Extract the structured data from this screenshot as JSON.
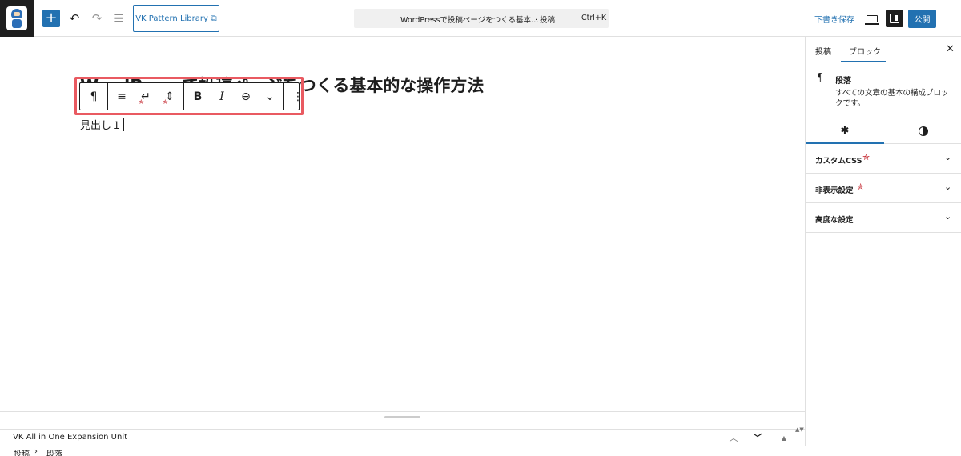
{
  "topbar": {
    "add_icon": "+",
    "undo_icon": "↶",
    "redo_icon": "↷",
    "outline_icon": "☰",
    "pattern_library_label": "VK Pattern Library",
    "external_icon": "⧉",
    "doc_title": "WordPressで投稿ページをつくる基本…",
    "doc_type": "· 投稿",
    "doc_shortcut": "Ctrl+K",
    "save_draft_label": "下書き保存",
    "publish_label": "公開"
  },
  "editor": {
    "post_title": "WordPressで投稿ページをつくる基本的な操作方法",
    "paragraph_text": "見出し１",
    "toolbar": {
      "paragraph_icon": "¶",
      "align_icon": "≡",
      "linebreak_icon": "↵",
      "spacing_icon": "⇕",
      "bold_label": "B",
      "italic_label": "I",
      "link_icon": "⊖",
      "more_icon": "⌄",
      "options_icon": "⋮",
      "vk_badge": "✯"
    },
    "highlight_color": "#e95a61"
  },
  "metabox": {
    "title": "VK All in One Expansion Unit",
    "up_icon": "︿",
    "down_icon": "﹀",
    "toggle_icon": "▲",
    "drag_icon": "▲▼"
  },
  "breadcrumb": {
    "items": [
      "投稿",
      "段落"
    ],
    "separator": "›"
  },
  "sidebar": {
    "tabs": [
      "投稿",
      "ブロック"
    ],
    "close_icon": "✕",
    "block": {
      "icon": "¶",
      "name": "段落",
      "description": "すべての文章の基本の構成ブロックです。"
    },
    "settings_icon": "✱",
    "panels": [
      {
        "label": "カスタムCSS",
        "vk": "✯"
      },
      {
        "label": "非表示設定",
        "vk": "✯"
      },
      {
        "label": "高度な設定",
        "vk": ""
      }
    ],
    "chevron_icon": "⌄"
  },
  "colors": {
    "accent": "#2271b1",
    "dark": "#1e1e1e",
    "vk_red": "#c4262e"
  }
}
